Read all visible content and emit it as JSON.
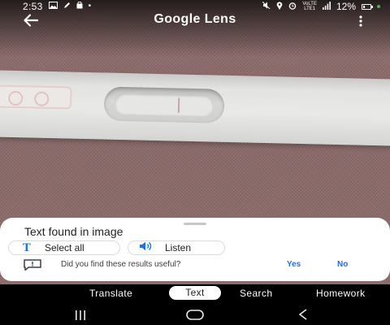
{
  "status_bar": {
    "time": "2:53",
    "left_icons": [
      "image-icon",
      "pen-icon",
      "shopping-bag-icon",
      "dot-icon"
    ],
    "right_icons": [
      "mute-icon",
      "location-icon",
      "alarm-icon",
      "network-speed-icon",
      "signal-icon",
      "battery-icon"
    ],
    "network_label_top": "VoLTE",
    "network_label_bottom": "LTE1",
    "battery": "12%"
  },
  "app_bar": {
    "title": "Google Lens",
    "back_icon": "arrow-left-icon",
    "menu_icon": "more-vert-icon"
  },
  "sheet": {
    "title": "Text found in image",
    "select_all_icon": "T",
    "select_all_label": "Select all",
    "listen_label": "Listen",
    "feedback_question": "Did you find these results useful?",
    "yes_label": "Yes",
    "no_label": "No"
  },
  "mode_tabs": [
    {
      "label": "Translate",
      "selected": false
    },
    {
      "label": "Text",
      "selected": true
    },
    {
      "label": "Search",
      "selected": false
    },
    {
      "label": "Homework",
      "selected": false
    }
  ],
  "colors": {
    "accent": "#1a73e8",
    "sheet_bg": "#ffffff",
    "background": "#000000"
  }
}
